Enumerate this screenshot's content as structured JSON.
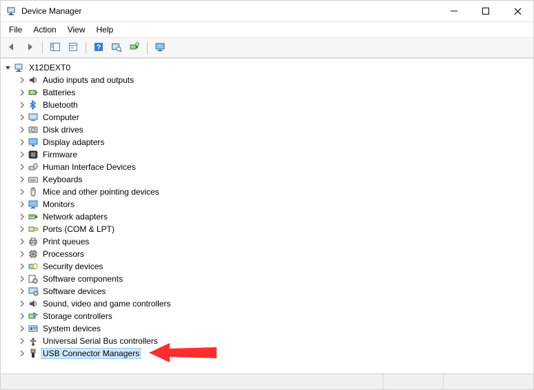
{
  "window": {
    "title": "Device Manager"
  },
  "menubar": {
    "items": [
      "File",
      "Action",
      "View",
      "Help"
    ]
  },
  "toolbar": {
    "buttons": [
      {
        "name": "back-button",
        "icon": "arrow-left-icon"
      },
      {
        "name": "forward-button",
        "icon": "arrow-right-icon"
      },
      {
        "sep": true
      },
      {
        "name": "show-hide-tree-button",
        "icon": "tree-pane-icon"
      },
      {
        "name": "properties-button",
        "icon": "properties-icon"
      },
      {
        "sep": true
      },
      {
        "name": "help-button",
        "icon": "help-icon"
      },
      {
        "name": "scan-hardware-button",
        "icon": "scan-icon"
      },
      {
        "name": "add-legacy-button",
        "icon": "add-hw-icon"
      },
      {
        "sep": true
      },
      {
        "name": "devices-printers-button",
        "icon": "monitor-icon"
      }
    ]
  },
  "tree": {
    "root": {
      "label": "X12DEXT0",
      "icon": "computer-root-icon",
      "expanded": true
    },
    "categories": [
      {
        "label": "Audio inputs and outputs",
        "icon": "audio-icon"
      },
      {
        "label": "Batteries",
        "icon": "battery-icon"
      },
      {
        "label": "Bluetooth",
        "icon": "bluetooth-icon"
      },
      {
        "label": "Computer",
        "icon": "computer-icon"
      },
      {
        "label": "Disk drives",
        "icon": "disk-icon"
      },
      {
        "label": "Display adapters",
        "icon": "display-icon"
      },
      {
        "label": "Firmware",
        "icon": "firmware-icon"
      },
      {
        "label": "Human Interface Devices",
        "icon": "hid-icon"
      },
      {
        "label": "Keyboards",
        "icon": "keyboard-icon"
      },
      {
        "label": "Mice and other pointing devices",
        "icon": "mouse-icon"
      },
      {
        "label": "Monitors",
        "icon": "monitor-icon"
      },
      {
        "label": "Network adapters",
        "icon": "network-icon"
      },
      {
        "label": "Ports (COM & LPT)",
        "icon": "port-icon"
      },
      {
        "label": "Print queues",
        "icon": "printer-icon"
      },
      {
        "label": "Processors",
        "icon": "cpu-icon"
      },
      {
        "label": "Security devices",
        "icon": "security-icon"
      },
      {
        "label": "Software components",
        "icon": "software-comp-icon"
      },
      {
        "label": "Software devices",
        "icon": "software-dev-icon"
      },
      {
        "label": "Sound, video and game controllers",
        "icon": "sound-icon"
      },
      {
        "label": "Storage controllers",
        "icon": "storage-icon"
      },
      {
        "label": "System devices",
        "icon": "system-icon"
      },
      {
        "label": "Universal Serial Bus controllers",
        "icon": "usb-icon"
      },
      {
        "label": "USB Connector Managers",
        "icon": "usb-connector-icon",
        "selected": true
      }
    ]
  },
  "arrow": {
    "color": "#ff2d2d",
    "target_name": "category-USB-Connector-Managers"
  }
}
